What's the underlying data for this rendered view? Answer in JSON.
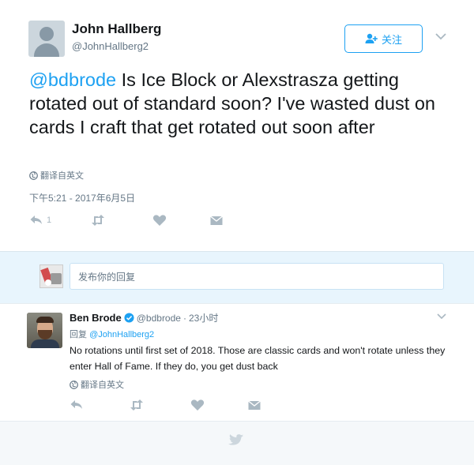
{
  "tweet": {
    "author_name": "John Hallberg",
    "author_handle": "@JohnHallberg2",
    "follow_label": "关注",
    "mention": "@bdbrode",
    "text": " Is Ice Block or Alexstrasza getting rotated out of standard soon? I've wasted dust on cards I craft that get rotated out soon after",
    "translate_label": "翻译自英文",
    "timestamp": "下午5:21 - 2017年6月5日",
    "reply_count": "1"
  },
  "reply_box": {
    "placeholder": "发布你的回复"
  },
  "reply": {
    "author_name": "Ben Brode",
    "author_handle": "@bdbrode",
    "separator": "·",
    "time_ago": "23小时",
    "replying_prefix": "回复",
    "replying_to": "@JohnHallberg2",
    "text": "No rotations until first set of 2018. Those are classic cards and won't rotate unless they enter Hall of Fame. If they do, you get dust back",
    "translate_label": "翻译自英文"
  },
  "colors": {
    "accent": "#1da1f2",
    "muted": "#657786",
    "icon": "#aab8c2",
    "reply_bg": "#e8f5fd",
    "footer_bg": "#f5f8fa"
  },
  "icons": {
    "follow": "person-plus-icon",
    "more": "chevron-down-icon",
    "translate": "globe-icon",
    "reply": "reply-icon",
    "retweet": "retweet-icon",
    "like": "heart-icon",
    "dm": "envelope-icon",
    "verified": "verified-badge-icon",
    "footer": "twitter-bird-icon"
  }
}
